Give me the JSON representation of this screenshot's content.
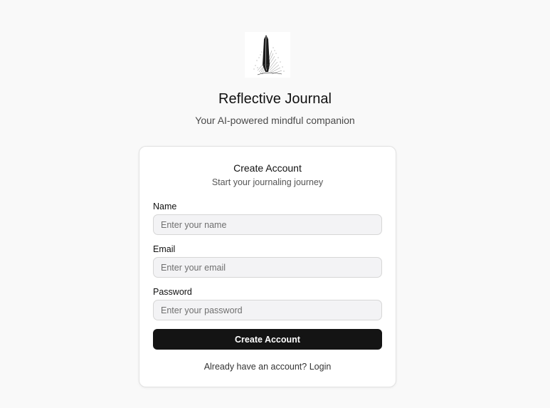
{
  "header": {
    "logo_icon": "fountain-pen-sketch-icon",
    "title": "Reflective Journal",
    "subtitle": "Your AI-powered mindful companion"
  },
  "card": {
    "title": "Create Account",
    "description": "Start your journaling journey",
    "fields": [
      {
        "label": "Name",
        "placeholder": "Enter your name",
        "value": ""
      },
      {
        "label": "Email",
        "placeholder": "Enter your email",
        "value": ""
      },
      {
        "label": "Password",
        "placeholder": "Enter your password",
        "value": ""
      }
    ],
    "submit_label": "Create Account",
    "footer_prompt": "Already have an account?",
    "login_label": "Login"
  },
  "colors": {
    "background": "#f9f9f9",
    "button": "#141414",
    "input_background": "#f3f3f5"
  }
}
